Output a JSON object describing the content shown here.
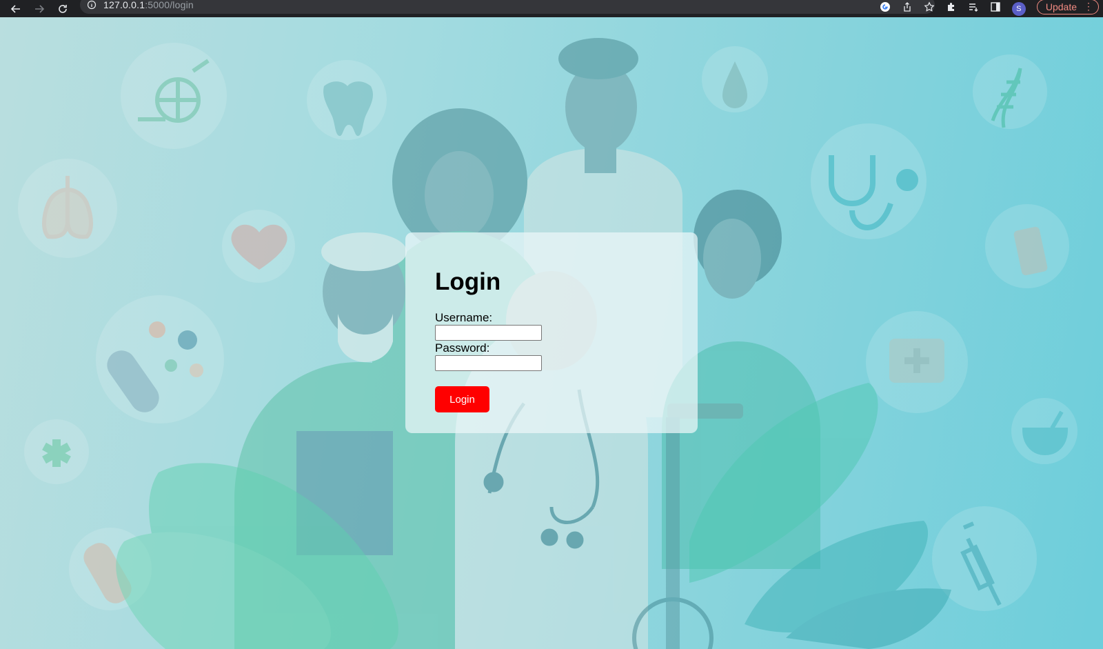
{
  "browser": {
    "url_host": "127.0.0.1",
    "url_rest": ":5000/login",
    "profile_initial": "S",
    "update_label": "Update",
    "menu_glyph": "⋮"
  },
  "login": {
    "title": "Login",
    "username_label": "Username:",
    "username_value": "",
    "password_label": "Password:",
    "password_value": "",
    "submit_label": "Login"
  },
  "colors": {
    "button": "#ff0000",
    "card": "#ecf7f8",
    "background_left": "#b9dedf",
    "background_right": "#6dcedb"
  }
}
